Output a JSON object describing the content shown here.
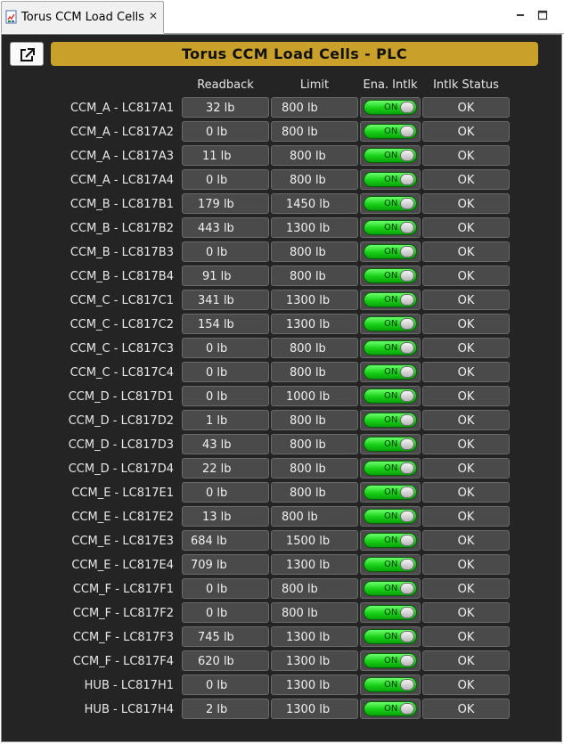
{
  "tab": {
    "title": "Torus CCM Load Cells",
    "close_glyph": "✕"
  },
  "panel": {
    "title": "Torus CCM Load Cells - PLC",
    "columns": {
      "readback": "Readback",
      "limit": "Limit",
      "enable_interlock": "Ena. Intlk",
      "interlock_status": "Intlk Status"
    },
    "rows": [
      {
        "name": "CCM_A - LC817A1",
        "readback": "32 lb",
        "limit": "800 lb",
        "enable": "ON",
        "status": "OK"
      },
      {
        "name": "CCM_A - LC817A2",
        "readback": "0 lb",
        "limit": "800 lb",
        "enable": "ON",
        "status": "OK"
      },
      {
        "name": "CCM_A - LC817A3",
        "readback": "11 lb",
        "limit": "800 lb",
        "enable": "ON",
        "status": "OK"
      },
      {
        "name": "CCM_A - LC817A4",
        "readback": "0 lb",
        "limit": "800 lb",
        "enable": "ON",
        "status": "OK"
      },
      {
        "name": "CCM_B - LC817B1",
        "readback": "179 lb",
        "limit": "1450 lb",
        "enable": "ON",
        "status": "OK"
      },
      {
        "name": "CCM_B - LC817B2",
        "readback": "443 lb",
        "limit": "1300 lb",
        "enable": "ON",
        "status": "OK"
      },
      {
        "name": "CCM_B - LC817B3",
        "readback": "0 lb",
        "limit": "800 lb",
        "enable": "ON",
        "status": "OK"
      },
      {
        "name": "CCM_B - LC817B4",
        "readback": "91 lb",
        "limit": "800 lb",
        "enable": "ON",
        "status": "OK"
      },
      {
        "name": "CCM_C - LC817C1",
        "readback": "341 lb",
        "limit": "1300 lb",
        "enable": "ON",
        "status": "OK"
      },
      {
        "name": "CCM_C - LC817C2",
        "readback": "154 lb",
        "limit": "1300 lb",
        "enable": "ON",
        "status": "OK"
      },
      {
        "name": "CCM_C - LC817C3",
        "readback": "0 lb",
        "limit": "800 lb",
        "enable": "ON",
        "status": "OK"
      },
      {
        "name": "CCM_C - LC817C4",
        "readback": "0 lb",
        "limit": "800 lb",
        "enable": "ON",
        "status": "OK"
      },
      {
        "name": "CCM_D - LC817D1",
        "readback": "0 lb",
        "limit": "1000 lb",
        "enable": "ON",
        "status": "OK"
      },
      {
        "name": "CCM_D - LC817D2",
        "readback": "1 lb",
        "limit": "800 lb",
        "enable": "ON",
        "status": "OK"
      },
      {
        "name": "CCM_D - LC817D3",
        "readback": "43 lb",
        "limit": "800 lb",
        "enable": "ON",
        "status": "OK"
      },
      {
        "name": "CCM_D - LC817D4",
        "readback": "22 lb",
        "limit": "800 lb",
        "enable": "ON",
        "status": "OK"
      },
      {
        "name": "CCM_E - LC817E1",
        "readback": "0 lb",
        "limit": "800 lb",
        "enable": "ON",
        "status": "OK"
      },
      {
        "name": "CCM_E - LC817E2",
        "readback": "13 lb",
        "limit": "800 lb",
        "enable": "ON",
        "status": "OK"
      },
      {
        "name": "CCM_E - LC817E3",
        "readback": "684 lb",
        "limit": "1500 lb",
        "enable": "ON",
        "status": "OK"
      },
      {
        "name": "CCM_E - LC817E4",
        "readback": "709 lb",
        "limit": "1300 lb",
        "enable": "ON",
        "status": "OK"
      },
      {
        "name": "CCM_F - LC817F1",
        "readback": "0 lb",
        "limit": "800 lb",
        "enable": "ON",
        "status": "OK"
      },
      {
        "name": "CCM_F - LC817F2",
        "readback": "0 lb",
        "limit": "800 lb",
        "enable": "ON",
        "status": "OK"
      },
      {
        "name": "CCM_F - LC817F3",
        "readback": "745 lb",
        "limit": "1300 lb",
        "enable": "ON",
        "status": "OK"
      },
      {
        "name": "CCM_F - LC817F4",
        "readback": "620 lb",
        "limit": "1300 lb",
        "enable": "ON",
        "status": "OK"
      },
      {
        "name": "HUB - LC817H1",
        "readback": "0 lb",
        "limit": "1300 lb",
        "enable": "ON",
        "status": "OK"
      },
      {
        "name": "HUB - LC817H4",
        "readback": "2 lb",
        "limit": "1300 lb",
        "enable": "ON",
        "status": "OK"
      }
    ]
  },
  "icons": {
    "tab": "display-file-icon",
    "open": "open-external-icon",
    "minimize": "minimize-icon",
    "maximize": "maximize-icon"
  },
  "colors": {
    "panel_background": "#242424",
    "header_bar": "#c9a12a",
    "toggle_on": "#17d017",
    "cell_background": "#4a4a4a"
  }
}
